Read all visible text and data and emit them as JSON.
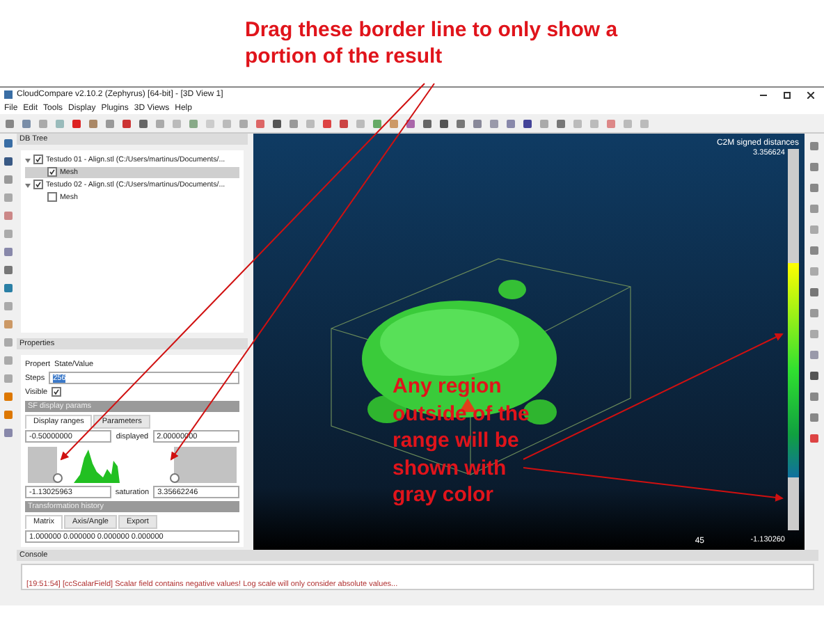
{
  "annotations": [
    {
      "text": "Drag these border line to only show a portion of the result"
    },
    {
      "text": "Any region outside of the range will be shown with gray color"
    }
  ],
  "window": {
    "title": "CloudCompare v2.10.2 (Zephyrus) [64-bit] - [3D View 1]"
  },
  "menu": [
    "File",
    "Edit",
    "Tools",
    "Display",
    "Plugins",
    "3D Views",
    "Help"
  ],
  "db_tree": {
    "title": "DB Tree",
    "items": [
      {
        "label": "Testudo 01 - Align.stl (C:/Users/martinus/Documents/...",
        "checked": true,
        "expanded": true,
        "selected": false,
        "children": [
          {
            "label": "Mesh",
            "checked": true,
            "selected": true
          }
        ]
      },
      {
        "label": "Testudo 02 - Align.stl (C:/Users/martinus/Documents/...",
        "checked": true,
        "expanded": true,
        "selected": false,
        "children": [
          {
            "label": "Mesh",
            "checked": false,
            "selected": false
          }
        ]
      }
    ]
  },
  "properties": {
    "title": "Properties",
    "columns": [
      "Propert",
      "State/Value"
    ],
    "steps": {
      "label": "Steps",
      "value": "256"
    },
    "visible": {
      "label": "Visible",
      "checked": true
    },
    "section": "SF display params",
    "tabs": [
      {
        "label": "Display ranges",
        "selected": true
      },
      {
        "label": "Parameters",
        "selected": false
      }
    ],
    "display_min": "-0.50000000",
    "displayed_label": "displayed",
    "display_max": "2.00000000",
    "range_handles": [
      {
        "level": 0.14
      },
      {
        "level": 0.7
      }
    ],
    "range_min": "-1.13025963",
    "saturation_label": "saturation",
    "saturation": "3.35662246",
    "transformation": {
      "title": "Transformation history",
      "tabs": [
        {
          "label": "Matrix",
          "selected": true
        },
        {
          "label": "Axis/Angle",
          "selected": false
        },
        {
          "label": "Export",
          "selected": false
        }
      ],
      "row": "1.000000 0.000000 0.000000 0.000000"
    }
  },
  "view": {
    "scale_title": "C2M signed distances",
    "scale_max": "3.356624",
    "scale_min": "-1.130260",
    "scale_bar_label": "45"
  },
  "console": {
    "title": "Console",
    "message": "[19:51:54] [ccScalarField] Scalar field contains negative values! Log scale will only consider absolute values..."
  }
}
